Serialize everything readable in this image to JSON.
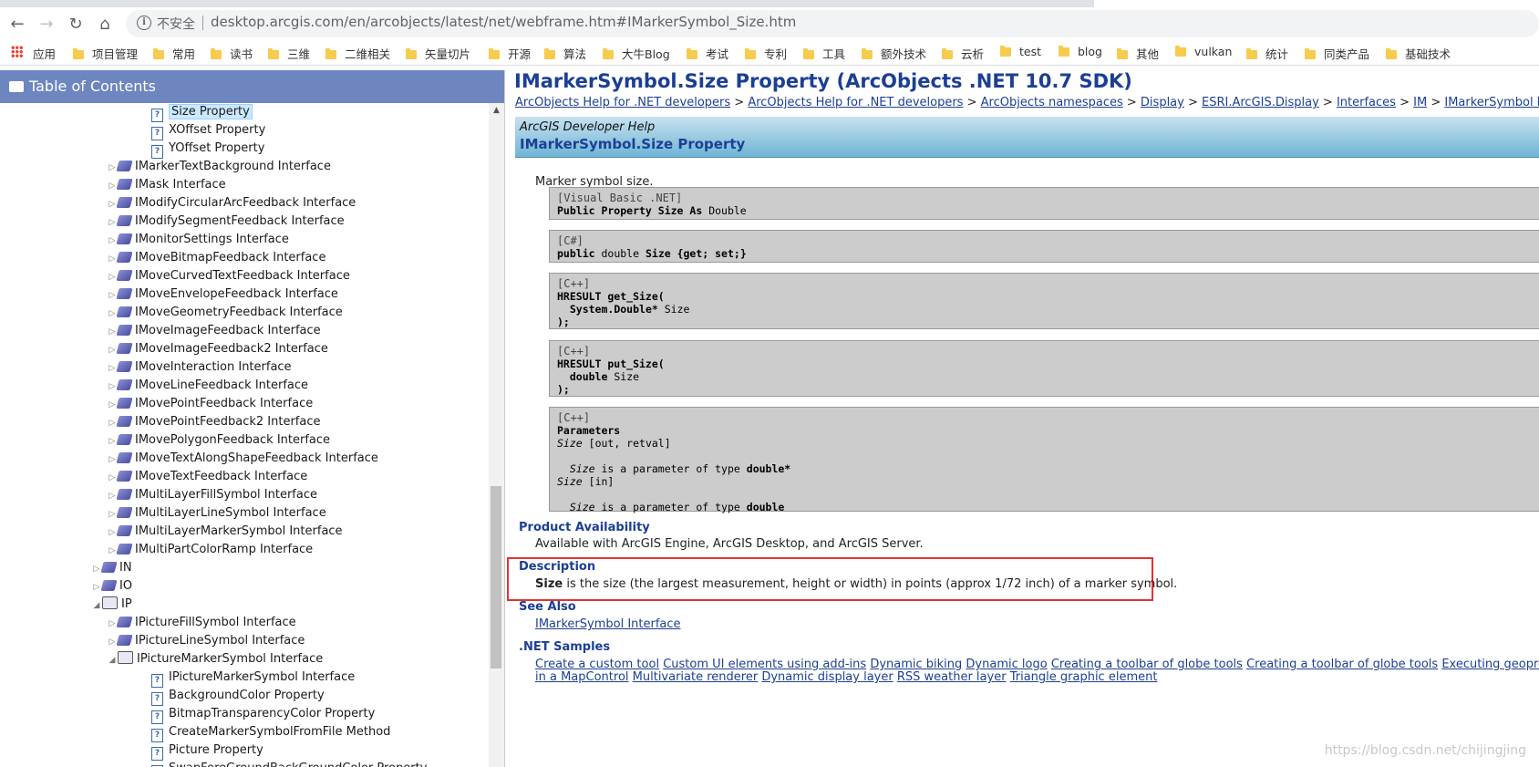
{
  "browser": {
    "insecure_label": "不安全",
    "url": "desktop.arcgis.com/en/arcobjects/latest/net/webframe.htm#IMarkerSymbol_Size.htm",
    "bookmarks": [
      "应用",
      "项目管理",
      "常用",
      "读书",
      "三维",
      "二维相关",
      "矢量切片",
      "开源",
      "算法",
      "大牛Blog",
      "考试",
      "专利",
      "工具",
      "额外技术",
      "云析",
      "test",
      "blog",
      "其他",
      "vulkan",
      "统计",
      "同类产品",
      "基础技术"
    ]
  },
  "toc": {
    "title": "Table of Contents",
    "items": [
      {
        "label": "Size Property",
        "type": "page",
        "level": 3,
        "selected": true
      },
      {
        "label": "XOffset Property",
        "type": "page",
        "level": 3
      },
      {
        "label": "YOffset Property",
        "type": "page",
        "level": 3
      },
      {
        "label": "IMarkerTextBackground Interface",
        "type": "iface",
        "level": 2
      },
      {
        "label": "IMask Interface",
        "type": "iface",
        "level": 2
      },
      {
        "label": "IModifyCircularArcFeedback Interface",
        "type": "iface",
        "level": 2
      },
      {
        "label": "IModifySegmentFeedback Interface",
        "type": "iface",
        "level": 2
      },
      {
        "label": "IMonitorSettings Interface",
        "type": "iface",
        "level": 2
      },
      {
        "label": "IMoveBitmapFeedback Interface",
        "type": "iface",
        "level": 2
      },
      {
        "label": "IMoveCurvedTextFeedback Interface",
        "type": "iface",
        "level": 2
      },
      {
        "label": "IMoveEnvelopeFeedback Interface",
        "type": "iface",
        "level": 2
      },
      {
        "label": "IMoveGeometryFeedback Interface",
        "type": "iface",
        "level": 2
      },
      {
        "label": "IMoveImageFeedback Interface",
        "type": "iface",
        "level": 2
      },
      {
        "label": "IMoveImageFeedback2 Interface",
        "type": "iface",
        "level": 2
      },
      {
        "label": "IMoveInteraction Interface",
        "type": "iface",
        "level": 2
      },
      {
        "label": "IMoveLineFeedback Interface",
        "type": "iface",
        "level": 2
      },
      {
        "label": "IMovePointFeedback Interface",
        "type": "iface",
        "level": 2
      },
      {
        "label": "IMovePointFeedback2 Interface",
        "type": "iface",
        "level": 2
      },
      {
        "label": "IMovePolygonFeedback Interface",
        "type": "iface",
        "level": 2
      },
      {
        "label": "IMoveTextAlongShapeFeedback Interface",
        "type": "iface",
        "level": 2
      },
      {
        "label": "IMoveTextFeedback Interface",
        "type": "iface",
        "level": 2
      },
      {
        "label": "IMultiLayerFillSymbol Interface",
        "type": "iface",
        "level": 2
      },
      {
        "label": "IMultiLayerLineSymbol Interface",
        "type": "iface",
        "level": 2
      },
      {
        "label": "IMultiLayerMarkerSymbol Interface",
        "type": "iface",
        "level": 2
      },
      {
        "label": "IMultiPartColorRamp Interface",
        "type": "iface",
        "level": 2
      },
      {
        "label": "IN",
        "type": "iface",
        "level": 1
      },
      {
        "label": "IO",
        "type": "iface",
        "level": 1
      },
      {
        "label": "IP",
        "type": "open",
        "level": 1,
        "expanded": true
      },
      {
        "label": "IPictureFillSymbol Interface",
        "type": "iface",
        "level": 2
      },
      {
        "label": "IPictureLineSymbol Interface",
        "type": "iface",
        "level": 2
      },
      {
        "label": "IPictureMarkerSymbol Interface",
        "type": "open",
        "level": 2,
        "expanded": true
      },
      {
        "label": "IPictureMarkerSymbol Interface",
        "type": "page",
        "level": 3
      },
      {
        "label": "BackgroundColor Property",
        "type": "page",
        "level": 3
      },
      {
        "label": "BitmapTransparencyColor Property",
        "type": "page",
        "level": 3
      },
      {
        "label": "CreateMarkerSymbolFromFile Method",
        "type": "page",
        "level": 3
      },
      {
        "label": "Picture Property",
        "type": "page",
        "level": 3
      },
      {
        "label": "SwapForeGroundBackGroundColor Property",
        "type": "page",
        "level": 3
      }
    ]
  },
  "page": {
    "title": "IMarkerSymbol.Size Property (ArcObjects .NET 10.7 SDK)",
    "breadcrumb": [
      "ArcObjects Help for .NET developers",
      "ArcObjects Help for .NET developers",
      "ArcObjects namespaces",
      "Display",
      "ESRI.ArcGIS.Display",
      "Interfaces",
      "IM",
      "IMarkerSymbol Interface"
    ],
    "breadcrumb_sep": ">",
    "banner_sub": "ArcGIS Developer Help",
    "banner_title": "IMarkerSymbol.Size Property",
    "summary": "Marker symbol size.",
    "syntax": {
      "vb": {
        "lang": "[Visual Basic .NET]",
        "kw": "Public Property Size As",
        "type": "Double"
      },
      "cs": {
        "lang": "[C#]",
        "kw1": "public",
        "type": "double",
        "kw2": "Size {get; set;}"
      },
      "cpp_get": {
        "lang": "[C++]",
        "l1": "HRESULT get_Size(",
        "l2_kw": "System.Double*",
        "l2_name": "Size",
        "l3": ");"
      },
      "cpp_put": {
        "lang": "[C++]",
        "l1": "HRESULT put_Size(",
        "l2_kw": "double",
        "l2_name": "Size",
        "l3": ");"
      },
      "params": {
        "lang": "[C++]",
        "title": "Parameters",
        "p1_name": "Size",
        "p1_attr": "[out, retval]",
        "p1_desc_name": "Size",
        "p1_desc": "is a parameter of type",
        "p1_type": "double*",
        "p2_name": "Size",
        "p2_attr": "[in]",
        "p2_desc_name": "Size",
        "p2_desc": "is a parameter of type",
        "p2_type": "double"
      }
    },
    "availability_title": "Product Availability",
    "availability_text": "Available with ArcGIS Engine, ArcGIS Desktop, and ArcGIS Server.",
    "description_title": "Description",
    "description_bold": "Size",
    "description_text": "is the size (the largest measurement, height or width) in points (approx 1/72 inch) of a marker symbol.",
    "see_also_title": "See Also",
    "see_also_link": "IMarkerSymbol Interface",
    "samples_title": ".NET Samples",
    "samples_row1": [
      "Create a custom tool",
      "Custom UI elements using add-ins",
      "Dynamic biking",
      "Dynamic logo",
      "Creating a toolbar of globe tools",
      "Creating a toolbar of globe tools",
      "Executing geoprocessing tools"
    ],
    "samples_row2": [
      "in a MapControl",
      "Multivariate renderer",
      "Dynamic display layer",
      "RSS weather layer",
      "Triangle graphic element"
    ],
    "watermark": "https://blog.csdn.net/chijingjing"
  }
}
